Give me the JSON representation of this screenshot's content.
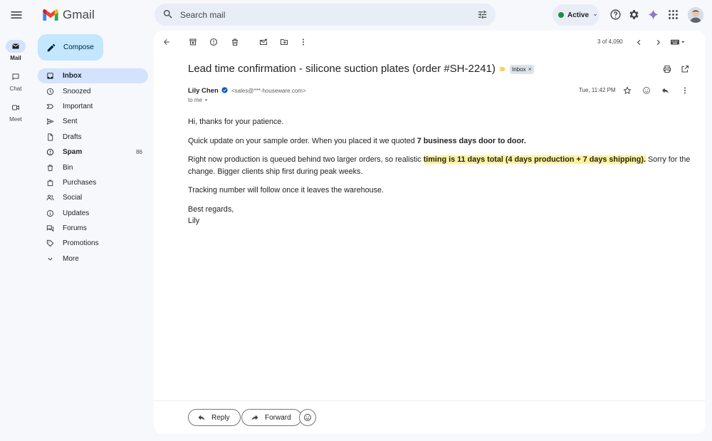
{
  "app": {
    "name": "Gmail"
  },
  "search": {
    "placeholder": "Search mail"
  },
  "status": {
    "label": "Active",
    "color": "#1e8e3e"
  },
  "rail": [
    {
      "label": "Mail",
      "icon": "mail-icon",
      "active": true
    },
    {
      "label": "Chat",
      "icon": "chat-icon",
      "active": false
    },
    {
      "label": "Meet",
      "icon": "video-icon",
      "active": false
    }
  ],
  "compose": {
    "label": "Compose"
  },
  "nav": [
    {
      "label": "Inbox",
      "icon": "inbox-icon",
      "selected": true,
      "bold": true,
      "count": ""
    },
    {
      "label": "Snoozed",
      "icon": "clock-icon",
      "selected": false,
      "bold": false,
      "count": ""
    },
    {
      "label": "Important",
      "icon": "important-icon",
      "selected": false,
      "bold": false,
      "count": ""
    },
    {
      "label": "Sent",
      "icon": "send-icon",
      "selected": false,
      "bold": false,
      "count": ""
    },
    {
      "label": "Drafts",
      "icon": "draft-icon",
      "selected": false,
      "bold": false,
      "count": ""
    },
    {
      "label": "Spam",
      "icon": "spam-icon",
      "selected": false,
      "bold": true,
      "count": "86"
    },
    {
      "label": "Bin",
      "icon": "trash-icon",
      "selected": false,
      "bold": false,
      "count": ""
    },
    {
      "label": "Purchases",
      "icon": "bag-icon",
      "selected": false,
      "bold": false,
      "count": ""
    },
    {
      "label": "Social",
      "icon": "people-icon",
      "selected": false,
      "bold": false,
      "count": ""
    },
    {
      "label": "Updates",
      "icon": "info-icon",
      "selected": false,
      "bold": false,
      "count": ""
    },
    {
      "label": "Forums",
      "icon": "forum-icon",
      "selected": false,
      "bold": false,
      "count": ""
    },
    {
      "label": "Promotions",
      "icon": "tag-icon",
      "selected": false,
      "bold": false,
      "count": ""
    },
    {
      "label": "More",
      "icon": "chevron-down-icon",
      "selected": false,
      "bold": false,
      "count": ""
    }
  ],
  "toolbar": {
    "pager": "3 of 4,090"
  },
  "email": {
    "subject": "Lead time confirmation - silicone suction plates (order #SH-2241)",
    "label_chip": "Inbox",
    "sender_name": "Lily Chen",
    "sender_email": "<sales@***-houseware.com>",
    "to": "to me",
    "date": "Tue, 11:42 PM",
    "greeting": "Hi, thanks for your patience.",
    "p1_text": "Quick update on your sample order. When you placed it we quoted ",
    "p1_bold": "7 business days door to door.",
    "p2_text": "Right now production is queued behind two larger orders, so realistic ",
    "p2_highlight": "timing is 11 days total (4 days production + 7 days shipping).",
    "p2_tail": " Sorry for the change. Bigger clients ship first during peak weeks.",
    "p3": "Tracking number will follow once it leaves the warehouse.",
    "signoff": "Best regards,",
    "signature": "Lily"
  },
  "actions": {
    "reply": "Reply",
    "forward": "Forward"
  }
}
